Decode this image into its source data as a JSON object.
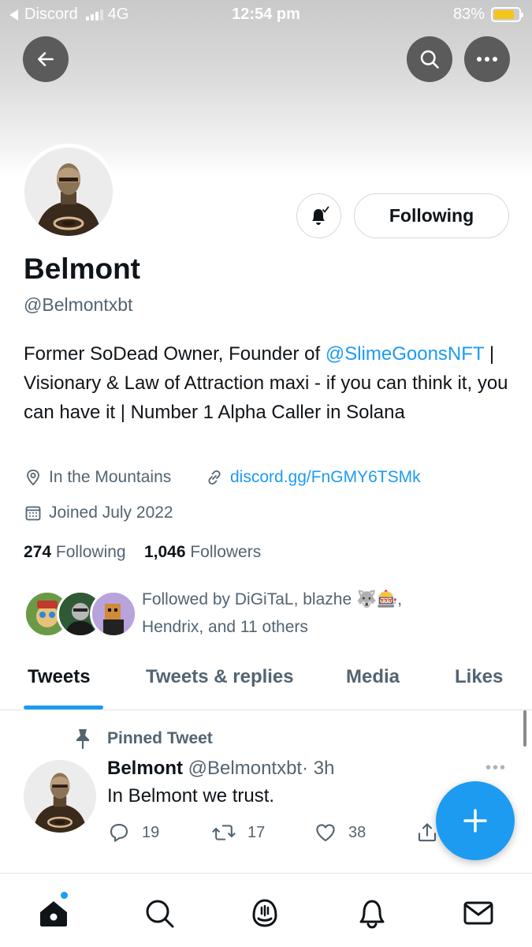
{
  "status_bar": {
    "back_app": "Discord",
    "network": "4G",
    "time": "12:54 pm",
    "battery": "83%",
    "battery_level": 0.83
  },
  "profile": {
    "name": "Belmont",
    "handle": "@Belmontxbt",
    "bio_part1": "Former SoDead Owner, Founder of ",
    "bio_mention": "@SlimeGoonsNFT",
    "bio_part2": " | Visionary & Law of Attraction maxi - if you can think it, you can have it | Number 1 Alpha Caller in Solana",
    "location": "In the Mountains",
    "link": "discord.gg/FnGMY6TSMk",
    "joined": "Joined July 2022",
    "following_count": "274",
    "following_label": "Following",
    "followers_count": "1,046",
    "followers_label": "Followers",
    "followed_by_line1": "Followed by DiGiTaL, blazhe 🐺🎰,",
    "followed_by_line2": "Hendrix, and 11 others",
    "follow_button": "Following"
  },
  "tabs": [
    {
      "label": "Tweets",
      "active": true
    },
    {
      "label": "Tweets & replies",
      "active": false
    },
    {
      "label": "Media",
      "active": false
    },
    {
      "label": "Likes",
      "active": false
    }
  ],
  "pinned_tweet": {
    "pinned_label": "Pinned Tweet",
    "author_name": "Belmont",
    "author_handle": "@Belmontxbt",
    "time": "· 3h",
    "text": "In Belmont we trust.",
    "more": "•••",
    "replies": "19",
    "retweets": "17",
    "likes": "38"
  },
  "colors": {
    "accent": "#1d9bf0",
    "text_primary": "#0f1419",
    "text_secondary": "#536471",
    "header_button": "#5b5b5b"
  },
  "icons": {
    "back": "arrow-left-icon",
    "search": "search-icon",
    "more": "more-horizontal-icon",
    "bell": "notification-bell-icon",
    "location": "location-pin-icon",
    "link": "link-icon",
    "calendar": "calendar-icon",
    "pin": "pin-icon",
    "reply": "reply-icon",
    "retweet": "retweet-icon",
    "like": "heart-icon",
    "share": "share-icon",
    "compose": "plus-icon",
    "nav_home": "home-icon",
    "nav_search": "search-icon",
    "nav_spaces": "spaces-icon",
    "nav_notifications": "bell-icon",
    "nav_messages": "mail-icon"
  }
}
